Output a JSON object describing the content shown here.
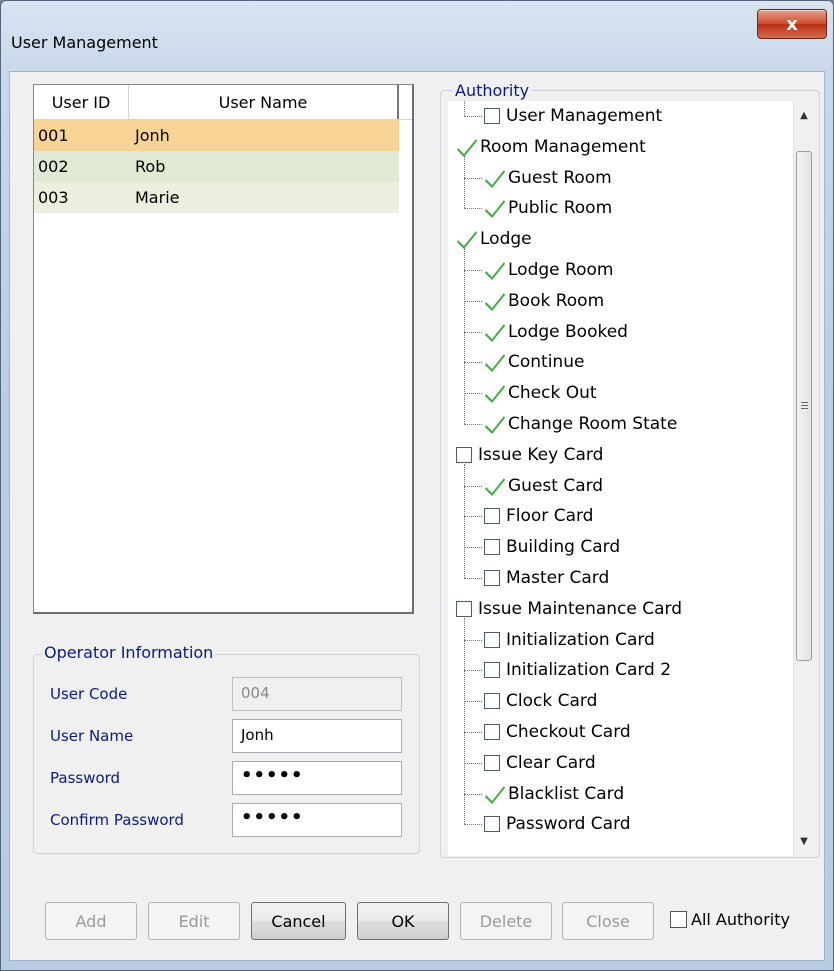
{
  "window": {
    "title": "User Management",
    "close_glyph": "x"
  },
  "user_list": {
    "columns": [
      "User ID",
      "User Name"
    ],
    "rows": [
      {
        "id": "001",
        "name": "Jonh"
      },
      {
        "id": "002",
        "name": "Rob"
      },
      {
        "id": "003",
        "name": "Marie"
      }
    ]
  },
  "operator": {
    "legend": "Operator Information",
    "user_code_label": "User Code",
    "user_code_value": "004",
    "user_name_label": "User Name",
    "user_name_value": "Jonh",
    "password_label": "Password",
    "password_value": "•••••",
    "confirm_label": "Confirm Password",
    "confirm_value": "•••••"
  },
  "authority": {
    "legend": "Authority",
    "items": [
      {
        "label": "User Management",
        "checked": false,
        "level": 1
      },
      {
        "label": "Room Management",
        "checked": true,
        "level": 0
      },
      {
        "label": "Guest Room",
        "checked": true,
        "level": 1
      },
      {
        "label": "Public Room",
        "checked": true,
        "level": 1
      },
      {
        "label": "Lodge",
        "checked": true,
        "level": 0
      },
      {
        "label": "Lodge Room",
        "checked": true,
        "level": 1
      },
      {
        "label": "Book Room",
        "checked": true,
        "level": 1
      },
      {
        "label": "Lodge Booked",
        "checked": true,
        "level": 1
      },
      {
        "label": "Continue",
        "checked": true,
        "level": 1
      },
      {
        "label": "Check Out",
        "checked": true,
        "level": 1
      },
      {
        "label": "Change Room State",
        "checked": true,
        "level": 1
      },
      {
        "label": "Issue Key Card",
        "checked": false,
        "level": 0
      },
      {
        "label": "Guest Card",
        "checked": true,
        "level": 1
      },
      {
        "label": "Floor Card",
        "checked": false,
        "level": 1
      },
      {
        "label": "Building Card",
        "checked": false,
        "level": 1
      },
      {
        "label": "Master Card",
        "checked": false,
        "level": 1
      },
      {
        "label": "Issue Maintenance Card",
        "checked": false,
        "level": 0
      },
      {
        "label": "Initialization Card",
        "checked": false,
        "level": 1
      },
      {
        "label": "Initialization Card 2",
        "checked": false,
        "level": 1
      },
      {
        "label": "Clock Card",
        "checked": false,
        "level": 1
      },
      {
        "label": "Checkout Card",
        "checked": false,
        "level": 1
      },
      {
        "label": "Clear Card",
        "checked": false,
        "level": 1
      },
      {
        "label": "Blacklist Card",
        "checked": true,
        "level": 1
      },
      {
        "label": "Password Card",
        "checked": false,
        "level": 1
      }
    ]
  },
  "buttons": {
    "add": "Add",
    "edit": "Edit",
    "cancel": "Cancel",
    "ok": "OK",
    "delete": "Delete",
    "close": "Close",
    "all_authority": "All Authority"
  },
  "colors": {
    "check_green": "#3fae3f",
    "selected_row": "#f7d496",
    "label_blue": "#0a1a8a"
  }
}
